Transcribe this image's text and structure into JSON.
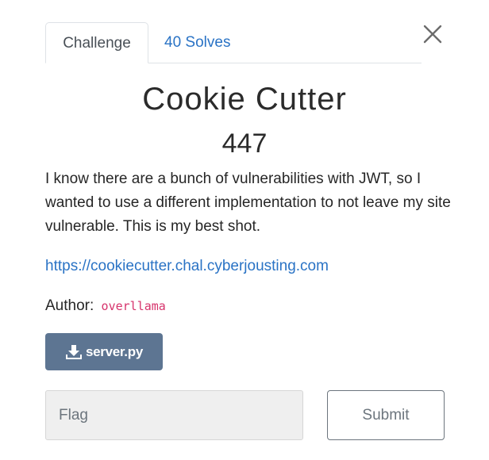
{
  "tabs": {
    "challenge_label": "Challenge",
    "solves_label": "40 Solves"
  },
  "challenge": {
    "name": "Cookie Cutter",
    "points": "447",
    "description": "I know there are a bunch of vulnerabilities with JWT, so I wanted to use a different implementation to not leave my site vulnerable. This is my best shot.",
    "link": "https://cookiecutter.chal.cyberjousting.com",
    "author_label": "Author:",
    "author_name": "overllama",
    "file_label": "server.py"
  },
  "form": {
    "flag_placeholder": "Flag",
    "submit_label": "Submit"
  },
  "icons": {
    "close": "close-icon",
    "download": "download-icon"
  },
  "colors": {
    "link": "#2a73c5",
    "download_button": "#5d7592",
    "author_code": "#d6336c"
  }
}
